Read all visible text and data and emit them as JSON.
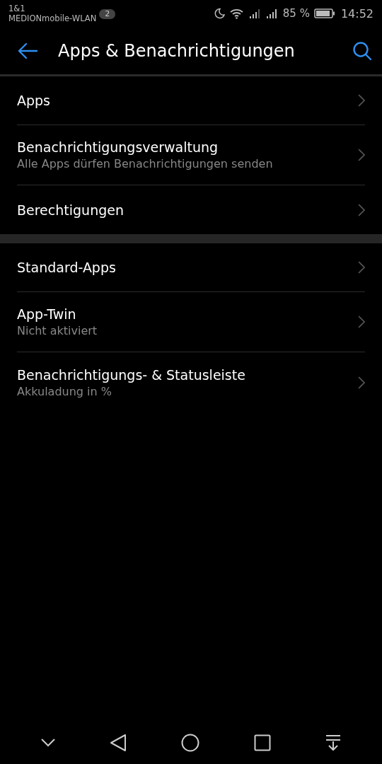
{
  "status_bar": {
    "carrier": "1&1",
    "network": "MEDIONmobile-WLAN",
    "notification_count": "2",
    "battery_percent": "85 %",
    "time": "14:52"
  },
  "header": {
    "title": "Apps & Benachrichtigungen"
  },
  "sections": [
    {
      "items": [
        {
          "title": "Apps"
        },
        {
          "title": "Benachrichtigungsverwaltung",
          "subtitle": "Alle Apps dürfen Benachrichtigungen senden"
        },
        {
          "title": "Berechtigungen"
        }
      ]
    },
    {
      "items": [
        {
          "title": "Standard-Apps"
        },
        {
          "title": "App-Twin",
          "subtitle": "Nicht aktiviert"
        },
        {
          "title": "Benachrichtigungs- & Statusleiste",
          "subtitle": "Akkuladung in %"
        }
      ]
    }
  ]
}
